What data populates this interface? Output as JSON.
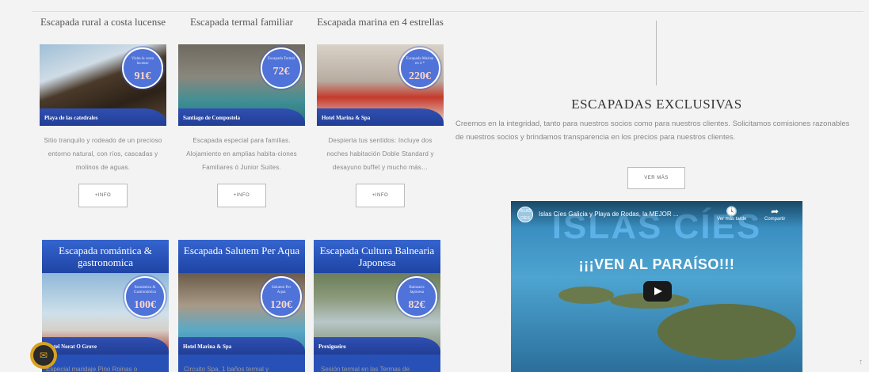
{
  "cards_row1": [
    {
      "title": "Escapada rural a costa lucense",
      "badge_text": "Visita la costa lucense",
      "price": "91€",
      "caption": "Playa de las catedrales",
      "desc": "Sitio tranquilo y rodeado de un precioso entorno natural, con ríos, cascadas y molinos de aguas.",
      "button": "+INFO"
    },
    {
      "title": "Escapada termal familiar",
      "badge_text": "Escapada Termal",
      "price": "72€",
      "caption": "Santiago de Compostela",
      "desc": "Escapada especial para familias. Alojamiento en amplias habita-ciones Familiares ó Junior Suites.",
      "button": "+INFO"
    },
    {
      "title": "Escapada marina en 4 estrellas",
      "badge_text": "Escapada Marina en 4 *",
      "price": "220€",
      "caption": "Hotel Marina & Spa",
      "desc": "Despierta tus sentidos: Incluye dos noches habitación Doble Standard y desayuno buffet y mucho más…",
      "button": "+INFO"
    }
  ],
  "cards_row2": [
    {
      "title": "Escapada romántica & gastronomica",
      "badge_text": "Romántica & Gastronómica",
      "price": "100€",
      "caption": "Hotel Norat O Grove",
      "cut_text": "Especial maridaje Pino Roinas o"
    },
    {
      "title": "Escapada Salutem Per Aqua",
      "badge_text": "Salutem Per Aqua",
      "price": "120€",
      "caption": "Hotel Marina & Spa",
      "cut_text": "Circuito Spa, 1 baños termal y"
    },
    {
      "title": "Escapada Cultura Balnearia Japonesa",
      "badge_text": "Balnearia Japonesa",
      "price": "82€",
      "caption": "Prexigueiro",
      "cut_text": "Sesión termal en las Termas de"
    }
  ],
  "exclusive": {
    "title": "ESCAPADAS EXCLUSIVAS",
    "text": "Creemos en la integridad, tanto para nuestros socios como para nuestros clientes. Solicitamos comisiones razonables de nuestros socios y brindamos transparencia en los precios para nuestros clientes.",
    "button": "VER MÁS"
  },
  "video": {
    "channel": "ISLAS CÍES",
    "title": "Islas Cíes Galicia y Playa de Rodas, la MEJOR ...",
    "big_text": "ISLAS CÍES",
    "sub_text": "¡¡¡VEN AL PARAÍSO!!!",
    "watch_later": "Ver más tarde",
    "share": "Compartir"
  },
  "icons": {
    "chat": "mail-chat-icon",
    "scroll": "scroll-up-icon"
  },
  "colors": {
    "card_blue": "#2851b8",
    "badge_blue": "#4f73d8",
    "chat_gold": "#d8a21e"
  }
}
